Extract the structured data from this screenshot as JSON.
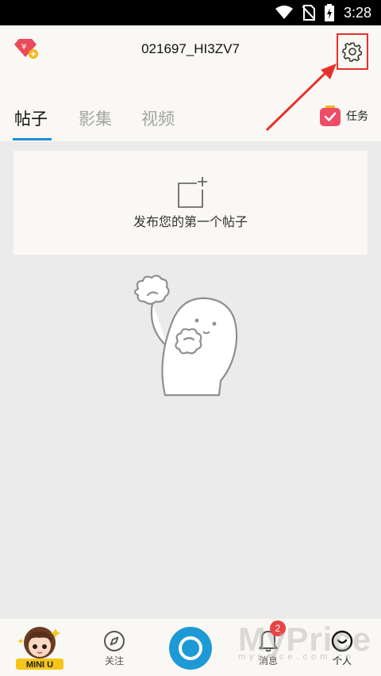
{
  "status_bar": {
    "time": "3:28",
    "icons": [
      "wifi-icon",
      "no-sim-icon",
      "battery-charging-icon"
    ]
  },
  "header": {
    "username": "021697_HI3ZV7",
    "vip_icon": "vip-diamond-icon",
    "settings_icon": "gear-icon",
    "highlight_color": "#e6312b"
  },
  "tabs": {
    "items": [
      {
        "label": "帖子",
        "active": true
      },
      {
        "label": "影集",
        "active": false
      },
      {
        "label": "视频",
        "active": false
      }
    ],
    "task_label": "任务",
    "accent_color": "#1d8fd8"
  },
  "post_card": {
    "label": "发布您的第一个帖子",
    "icon": "new-post-plus-icon"
  },
  "bottom_nav": {
    "mascot_label": "MINI U",
    "follow_label": "关注",
    "messages_label": "消息",
    "messages_badge": "2",
    "profile_label": "个人",
    "camera_color": "#1d9ad6"
  },
  "watermark": {
    "big": "MyPrice",
    "small": "myprice.com.cn"
  }
}
